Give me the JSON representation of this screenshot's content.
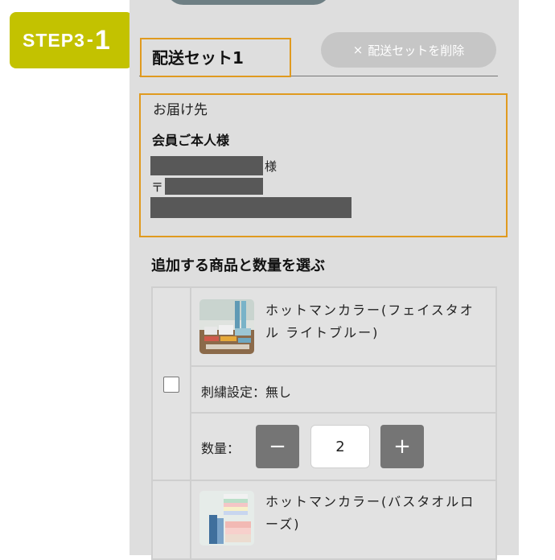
{
  "step": {
    "label": "STEP3",
    "separator": "-",
    "number": "1"
  },
  "delivery_set": {
    "title": "配送セット1",
    "delete_icon": "×",
    "delete_label": "配送セットを削除"
  },
  "address": {
    "heading": "お届け先",
    "member": "会員ご本人様",
    "name_suffix": "様",
    "postal_mark": "〒"
  },
  "items_section": {
    "heading": "追加する商品と数量を選ぶ",
    "items": [
      {
        "name": "ホットマンカラー(フェイスタオル ライトブルー)",
        "embroidery": "刺繍設定：無し",
        "quantity_label": "数量：",
        "quantity": "2",
        "minus": "−",
        "plus": "+"
      },
      {
        "name": "ホットマンカラー(バスタオルローズ)"
      }
    ]
  },
  "colors": {
    "step_badge": "#c3c200",
    "highlight": "#e09a1f",
    "panel_bg": "#dedede",
    "button_gray": "#757575"
  }
}
